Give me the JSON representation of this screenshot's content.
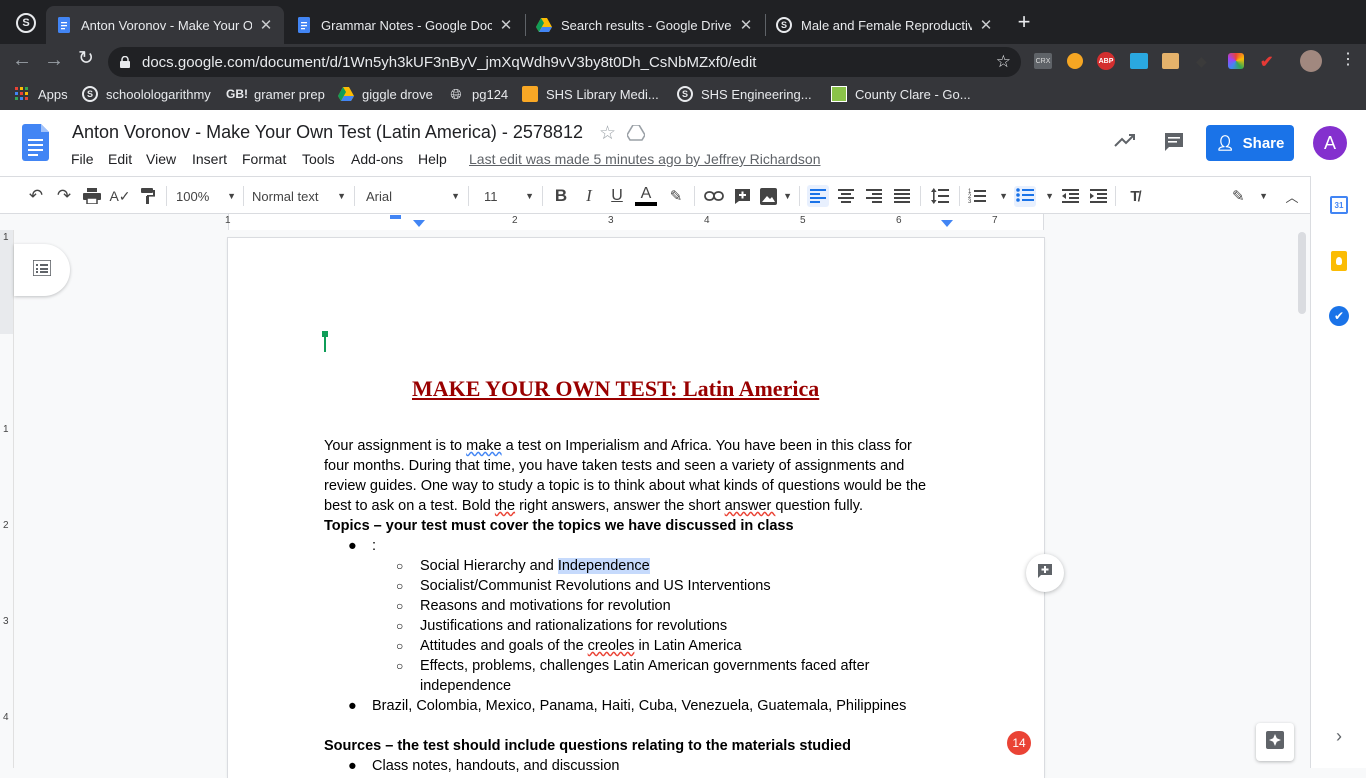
{
  "browser": {
    "tabs": [
      {
        "title": "Anton Voronov - Make Your Ow",
        "active": true,
        "icon": "docs-icon"
      },
      {
        "title": "Grammar Notes - Google Docs",
        "active": false,
        "icon": "docs-icon"
      },
      {
        "title": "Search results - Google Drive",
        "active": false,
        "icon": "drive-icon"
      },
      {
        "title": "Male and Female Reproductive",
        "active": false,
        "icon": "schoology-icon"
      }
    ],
    "url": "docs.google.com/document/d/1Wn5yh3kUF3nByV_jmXqWdh9vV3by8t0Dh_CsNbMZxf0/edit",
    "bookmarks": [
      {
        "label": "Apps"
      },
      {
        "label": "schoolologarithmy"
      },
      {
        "label": "gramer prep"
      },
      {
        "label": "giggle drove"
      },
      {
        "label": "pg124"
      },
      {
        "label": "SHS Library Medi..."
      },
      {
        "label": "SHS Engineering..."
      },
      {
        "label": "County Clare - Go..."
      }
    ],
    "bookmark_icon_labels": {
      "gb": "GB!",
      "shs": "S"
    },
    "extension_labels": {
      "crx": "CRX",
      "abp": "ABP"
    }
  },
  "docs": {
    "title": "Anton Voronov - Make Your Own Test (Latin America) - 2578812",
    "menus": [
      "File",
      "Edit",
      "View",
      "Insert",
      "Format",
      "Tools",
      "Add-ons",
      "Help"
    ],
    "last_edit": "Last edit was made 5 minutes ago by Jeffrey Richardson",
    "share_label": "Share",
    "avatar_letter": "A",
    "toolbar": {
      "zoom": "100%",
      "style": "Normal text",
      "font": "Arial",
      "size": "11"
    },
    "ruler_numbers": [
      "1",
      "1",
      "2",
      "3",
      "4",
      "5",
      "6",
      "7"
    ],
    "vruler_numbers": [
      "1",
      "1",
      "2",
      "3",
      "4"
    ],
    "notification_count": "14",
    "colors": {
      "share": "#1a73e8",
      "avatar": "#8430ce",
      "heading": "#990000",
      "badge": "#ea4335"
    }
  },
  "document": {
    "heading": "MAKE YOUR OWN TEST: Latin America",
    "intro": [
      {
        "pre": "Your assignment is to ",
        "mark": "make",
        "post": " a test on Imperialism and Africa.  You have been in this class for"
      },
      {
        "pre": "four months.  During that time, you have taken tests and seen a variety of assignments and",
        "mark": "",
        "post": ""
      },
      {
        "pre": "review guides.  One way to study a topic is to think about what kinds of questions would be the",
        "mark": "",
        "post": ""
      },
      {
        "pre": "best to ask on a test. Bold ",
        "mark": "the",
        "post": " right answers, answer the short "
      }
    ],
    "intro_tail": {
      "mark": "answer ",
      "post": "question fully."
    },
    "topics_heading": "Topics – your test must cover the topics we have discussed in class",
    "bullet1": ":",
    "subitems": [
      {
        "pre": "Social Hierarchy and ",
        "hl": "Independence",
        "post": ""
      },
      {
        "pre": "Socialist/Communist Revolutions and US Interventions",
        "hl": "",
        "post": ""
      },
      {
        "pre": "Reasons and motivations for revolution",
        "hl": "",
        "post": ""
      },
      {
        "pre": "Justifications and rationalizations for revolutions",
        "hl": "",
        "post": ""
      },
      {
        "pre": "Attitudes and goals of the ",
        "hl": "",
        "mark": "creoles",
        "post": " in Latin America"
      },
      {
        "pre": "Effects, problems, challenges Latin American governments faced after",
        "hl": "",
        "post": ""
      }
    ],
    "subitem_cont": "independence",
    "bullet2": "Brazil, Colombia, Mexico, Panama, Haiti, Cuba, Venezuela, Guatemala, Philippines",
    "sources_heading": "Sources – the test should include questions relating to the materials studied",
    "bullet3": "Class notes, handouts, and discussion"
  }
}
